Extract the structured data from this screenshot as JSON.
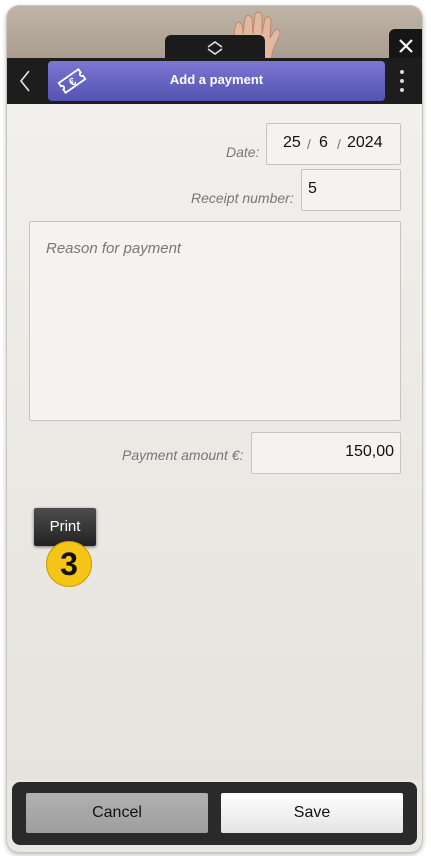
{
  "header": {
    "title": "Add a payment",
    "icon": "euro-ticket-icon",
    "accent_color": "#6664c4"
  },
  "form": {
    "date_label": "Date:",
    "date": {
      "day": "25",
      "month": "6",
      "year": "2024",
      "separator": "/"
    },
    "receipt_label": "Receipt number:",
    "receipt_value": "5",
    "reason_placeholder": "Reason for payment",
    "amount_label": "Payment amount €:",
    "amount_value": "150,00"
  },
  "print_button": {
    "label": "Print",
    "step_badge": "3"
  },
  "footer": {
    "cancel_label": "Cancel",
    "save_label": "Save"
  }
}
